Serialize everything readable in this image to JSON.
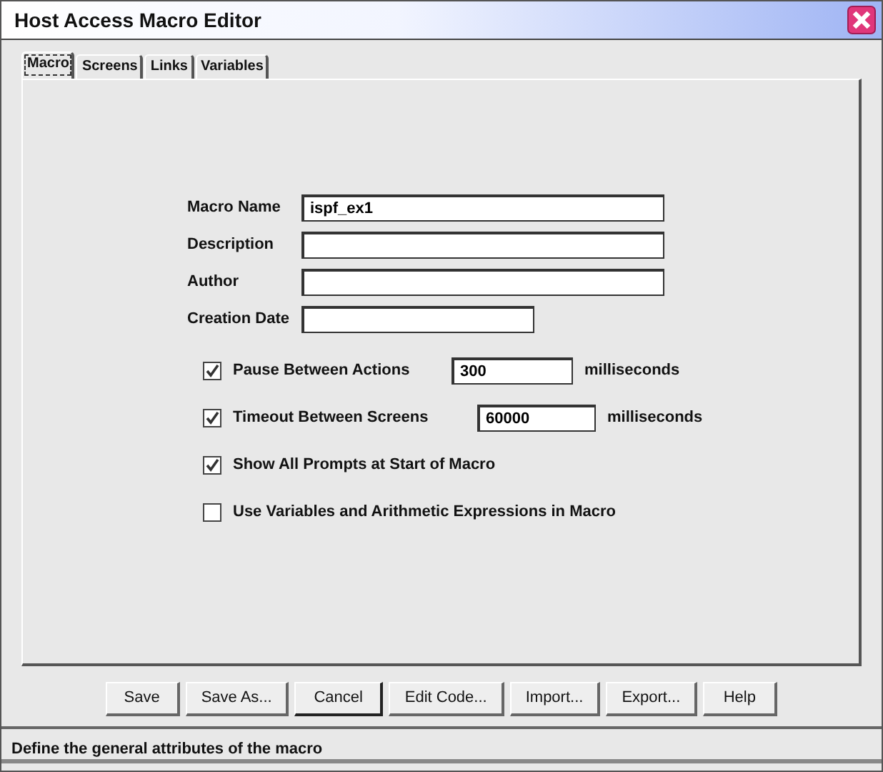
{
  "window": {
    "title": "Host Access Macro Editor"
  },
  "tabs": [
    {
      "label": "Macro",
      "selected": true
    },
    {
      "label": "Screens",
      "selected": false
    },
    {
      "label": "Links",
      "selected": false
    },
    {
      "label": "Variables",
      "selected": false
    }
  ],
  "fields": [
    {
      "label": "Macro Name",
      "value": "ispf_ex1",
      "kind": "long"
    },
    {
      "label": "Description",
      "kind": "long"
    },
    {
      "label": "Author",
      "kind": "long"
    },
    {
      "label": "Creation Date",
      "kind": "short"
    }
  ],
  "options": [
    {
      "label": "Pause Between Actions",
      "checked": true,
      "value": "300",
      "unit": "milliseconds"
    },
    {
      "label": "Timeout Between Screens",
      "checked": true,
      "value": "60000",
      "unit": "milliseconds"
    },
    {
      "label": "Show All Prompts at Start of Macro",
      "checked": true
    },
    {
      "label": "Use Variables and Arithmetic Expressions in Macro",
      "checked": false
    }
  ],
  "buttons": [
    {
      "label": "Save",
      "default": false
    },
    {
      "label": "Save As...",
      "default": false
    },
    {
      "label": "Cancel",
      "default": true
    },
    {
      "label": "Edit Code...",
      "default": false
    },
    {
      "label": "Import...",
      "default": false
    },
    {
      "label": "Export...",
      "default": false
    },
    {
      "label": "Help",
      "default": false
    }
  ],
  "status_bar": "Define the general attributes of the macro"
}
